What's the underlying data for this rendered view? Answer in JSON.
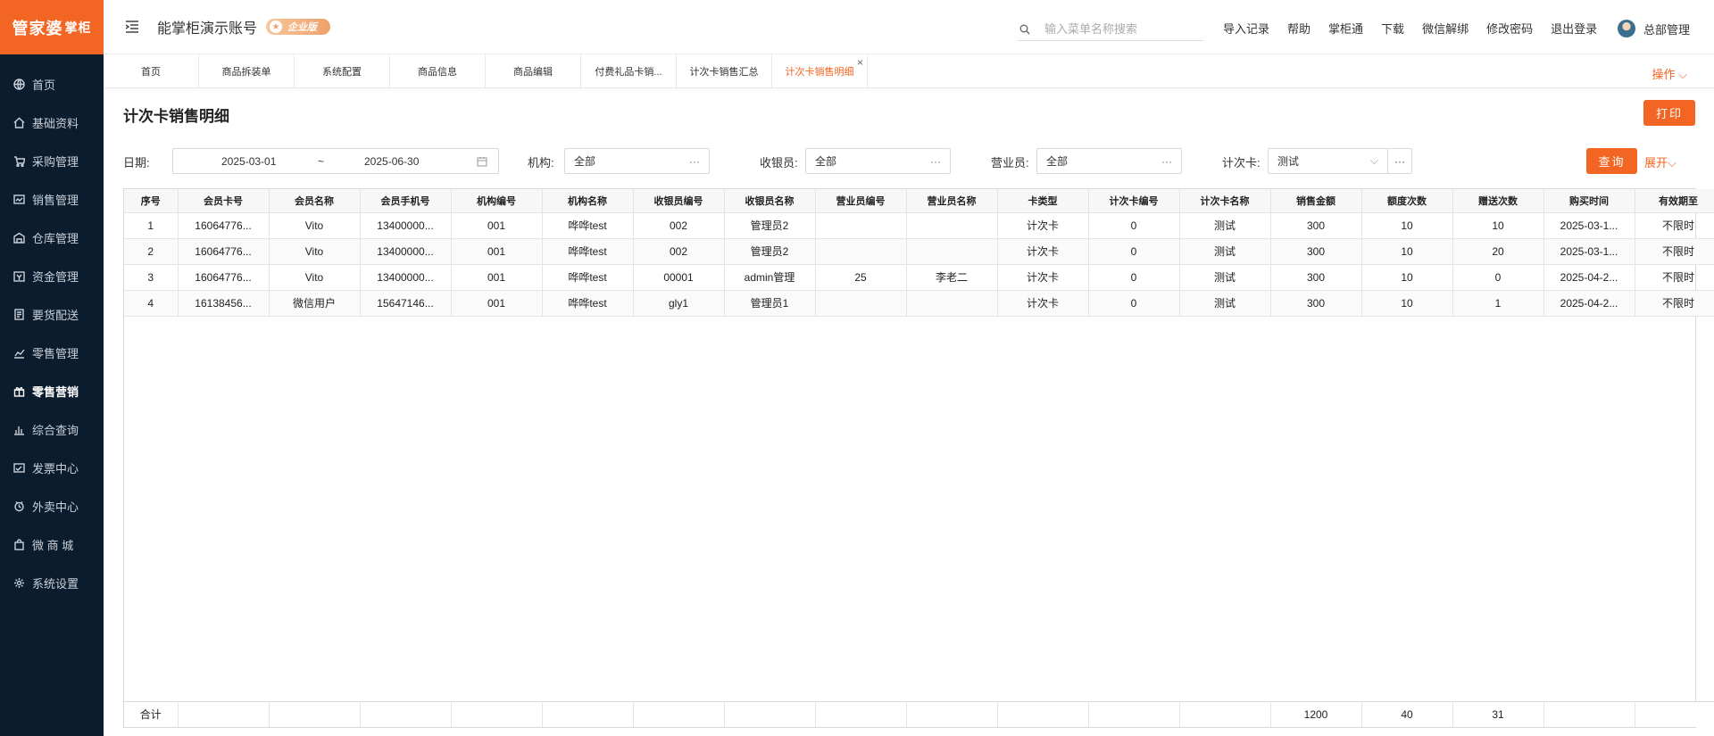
{
  "brand": {
    "name": "管家婆",
    "sub": "掌柜",
    "color": "#f26522"
  },
  "sidebar": {
    "items": [
      {
        "label": "首页",
        "icon": "globe-icon",
        "active": false
      },
      {
        "label": "基础资料",
        "icon": "home-icon",
        "active": false
      },
      {
        "label": "采购管理",
        "icon": "cart-icon",
        "active": false
      },
      {
        "label": "销售管理",
        "icon": "sales-icon",
        "active": false
      },
      {
        "label": "仓库管理",
        "icon": "warehouse-icon",
        "active": false
      },
      {
        "label": "资金管理",
        "icon": "funds-icon",
        "active": false
      },
      {
        "label": "要货配送",
        "icon": "delivery-icon",
        "active": false
      },
      {
        "label": "零售管理",
        "icon": "retail-chart-icon",
        "active": false
      },
      {
        "label": "零售营销",
        "icon": "gift-icon",
        "active": true
      },
      {
        "label": "综合查询",
        "icon": "bar-chart-icon",
        "active": false
      },
      {
        "label": "发票中心",
        "icon": "invoice-icon",
        "active": false
      },
      {
        "label": "外卖中心",
        "icon": "takeout-icon",
        "active": false
      },
      {
        "label": "微 商 城",
        "icon": "shop-bag-icon",
        "active": false
      },
      {
        "label": "系统设置",
        "icon": "gear-icon",
        "active": false
      }
    ]
  },
  "header": {
    "account": "能掌柜演示账号",
    "badge": "企业版",
    "search_placeholder": "输入菜单名称搜索",
    "links": [
      "导入记录",
      "帮助",
      "掌柜通",
      "下载",
      "微信解绑",
      "修改密码",
      "退出登录"
    ],
    "user": "总部管理"
  },
  "tabs": {
    "items": [
      {
        "label": "首页",
        "active": false
      },
      {
        "label": "商品拆装单",
        "active": false
      },
      {
        "label": "系统配置",
        "active": false
      },
      {
        "label": "商品信息",
        "active": false
      },
      {
        "label": "商品编辑",
        "active": false
      },
      {
        "label": "付费礼品卡销...",
        "active": false
      },
      {
        "label": "计次卡销售汇总",
        "active": false
      },
      {
        "label": "计次卡销售明细",
        "active": true
      }
    ],
    "close": "×",
    "ops": "操作"
  },
  "page": {
    "title": "计次卡销售明细",
    "print": "打印"
  },
  "filters": {
    "date_label": "日期:",
    "date_from": "2025-03-01",
    "date_sep": "~",
    "date_to": "2025-06-30",
    "org_label": "机构:",
    "org_value": "全部",
    "cashier_label": "收银员:",
    "cashier_value": "全部",
    "sales_label": "营业员:",
    "sales_value": "全部",
    "card_label": "计次卡:",
    "card_value": "测试",
    "query": "查询",
    "expand": "展开"
  },
  "table": {
    "columns": [
      "序号",
      "会员卡号",
      "会员名称",
      "会员手机号",
      "机构编号",
      "机构名称",
      "收银员编号",
      "收银员名称",
      "营业员编号",
      "营业员名称",
      "卡类型",
      "计次卡编号",
      "计次卡名称",
      "销售金额",
      "额度次数",
      "赠送次数",
      "购买时间",
      "有效期至"
    ],
    "rows": [
      [
        "1",
        "16064776...",
        "Vito",
        "13400000...",
        "001",
        "哗哗test",
        "002",
        "管理员2",
        "",
        "",
        "计次卡",
        "0",
        "测试",
        "300",
        "10",
        "10",
        "2025-03-1...",
        "不限时"
      ],
      [
        "2",
        "16064776...",
        "Vito",
        "13400000...",
        "001",
        "哗哗test",
        "002",
        "管理员2",
        "",
        "",
        "计次卡",
        "0",
        "测试",
        "300",
        "10",
        "20",
        "2025-03-1...",
        "不限时"
      ],
      [
        "3",
        "16064776...",
        "Vito",
        "13400000...",
        "001",
        "哗哗test",
        "00001",
        "admin管理",
        "25",
        "李老二",
        "计次卡",
        "0",
        "测试",
        "300",
        "10",
        "0",
        "2025-04-2...",
        "不限时"
      ],
      [
        "4",
        "16138456...",
        "微信用户",
        "15647146...",
        "001",
        "哗哗test",
        "gly1",
        "管理员1",
        "",
        "",
        "计次卡",
        "0",
        "测试",
        "300",
        "10",
        "1",
        "2025-04-2...",
        "不限时"
      ]
    ],
    "footer": [
      "合计",
      "",
      "",
      "",
      "",
      "",
      "",
      "",
      "",
      "",
      "",
      "",
      "",
      "1200",
      "40",
      "31",
      "",
      ""
    ]
  }
}
